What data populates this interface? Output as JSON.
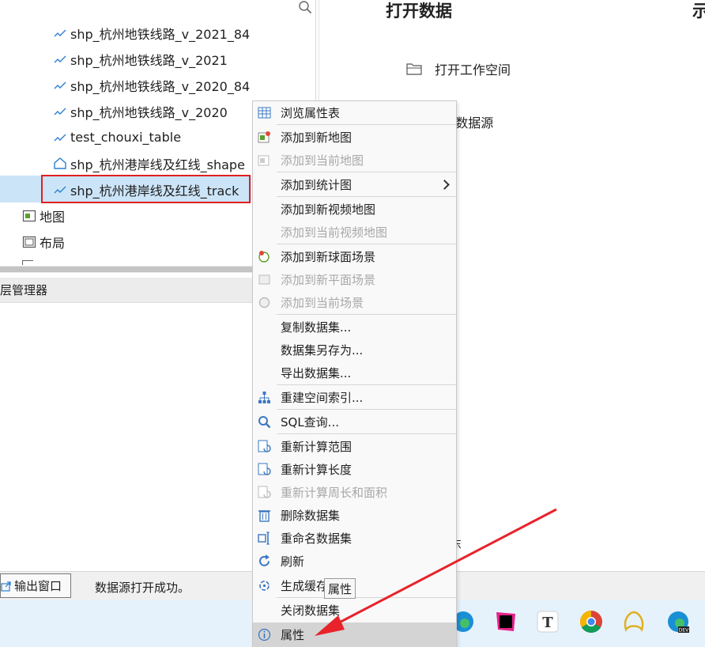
{
  "tree": {
    "items": [
      {
        "label": "shp_杭州地铁线路_v_2021_84",
        "icon": "line-dataset-icon"
      },
      {
        "label": "shp_杭州地铁线路_v_2021",
        "icon": "line-dataset-icon"
      },
      {
        "label": "shp_杭州地铁线路_v_2020_84",
        "icon": "line-dataset-icon"
      },
      {
        "label": "shp_杭州地铁线路_v_2020",
        "icon": "line-dataset-icon"
      },
      {
        "label": "test_chouxi_table",
        "icon": "line-dataset-icon"
      },
      {
        "label": "shp_杭州港岸线及红线_shape",
        "icon": "region-dataset-icon"
      },
      {
        "label": "shp_杭州港岸线及红线_track",
        "icon": "line-dataset-icon"
      }
    ],
    "map_label": "地图",
    "layout_label": "布局"
  },
  "layer_manager": {
    "title": "图层管理器"
  },
  "right_panel": {
    "title": "打开数据",
    "title_partial": "示",
    "open_workspace": "打开工作空间",
    "datasource_partial": "F数据源",
    "bottom_partial": "东"
  },
  "status_bar": {
    "output_button": "输出窗口",
    "message": "数据源打开成功。"
  },
  "context_menu": {
    "items": [
      {
        "label": "浏览属性表",
        "icon": "table-icon",
        "disabled": false
      },
      {
        "label": "添加到新地图",
        "icon": "new-map-icon",
        "disabled": false
      },
      {
        "label": "添加到当前地图",
        "icon": "current-map-icon",
        "disabled": true
      },
      {
        "label": "添加到统计图",
        "icon": "",
        "disabled": false,
        "submenu": true
      },
      {
        "label": "添加到新视频地图",
        "icon": "",
        "disabled": false
      },
      {
        "label": "添加到当前视频地图",
        "icon": "",
        "disabled": true
      },
      {
        "label": "添加到新球面场景",
        "icon": "globe-scene-icon",
        "disabled": false
      },
      {
        "label": "添加到新平面场景",
        "icon": "plane-scene-icon",
        "disabled": true
      },
      {
        "label": "添加到当前场景",
        "icon": "current-scene-icon",
        "disabled": true
      },
      {
        "label": "复制数据集...",
        "icon": "",
        "disabled": false
      },
      {
        "label": "数据集另存为...",
        "icon": "",
        "disabled": false
      },
      {
        "label": "导出数据集...",
        "icon": "",
        "disabled": false
      },
      {
        "label": "重建空间索引...",
        "icon": "spatial-index-icon",
        "disabled": false
      },
      {
        "label": "SQL查询...",
        "icon": "search-icon",
        "disabled": false
      },
      {
        "label": "重新计算范围",
        "icon": "recalc-icon",
        "disabled": false
      },
      {
        "label": "重新计算长度",
        "icon": "recalc-icon",
        "disabled": false
      },
      {
        "label": "重新计算周长和面积",
        "icon": "recalc-icon",
        "disabled": true
      },
      {
        "label": "删除数据集",
        "icon": "trash-icon",
        "disabled": false
      },
      {
        "label": "重命名数据集",
        "icon": "rename-icon",
        "disabled": false
      },
      {
        "label": "刷新",
        "icon": "refresh-icon",
        "disabled": false
      },
      {
        "label": "生成缓存",
        "icon": "cache-icon",
        "disabled": false
      },
      {
        "label": "关闭数据集",
        "icon": "",
        "disabled": false
      },
      {
        "label": "属性",
        "icon": "info-icon",
        "disabled": false
      }
    ],
    "tooltip": "属性"
  },
  "colors": {
    "selection_bg": "#cce4f7",
    "highlight_box": "#e02020",
    "arrow": "#e8232a",
    "taskbar": "#e6f2fb"
  }
}
